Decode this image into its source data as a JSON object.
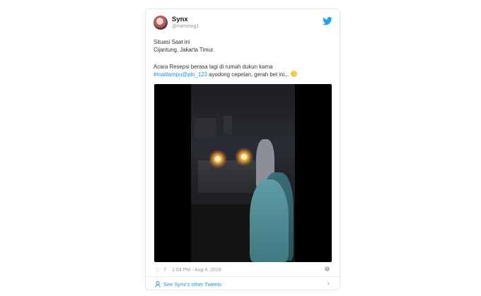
{
  "tweet": {
    "display_name": "Synx",
    "handle": "@menmog1",
    "lines": [
      "Situasi Saat ini",
      "Cijantung, Jakarta Timur.",
      "",
      "Acara Resepsi berasa lagi di rumah dukun karna"
    ],
    "hashtag": "#matilampu",
    "mention": "@pln_123",
    "line5_rest": " ayodong cepetan, gerah bet ini...",
    "likes": "7",
    "timestamp": "1:04 PM - Aug 4, 2019",
    "footer_link": "See Synx's other Tweets"
  },
  "colors": {
    "link": "#1b95e0",
    "twitter_blue": "#1da1f2",
    "muted": "#8899a6"
  },
  "icons": {
    "bird": "twitter-bird-icon",
    "heart": "heart-icon",
    "info": "info-icon",
    "person": "person-icon",
    "chevron": "chevron-right-icon"
  }
}
